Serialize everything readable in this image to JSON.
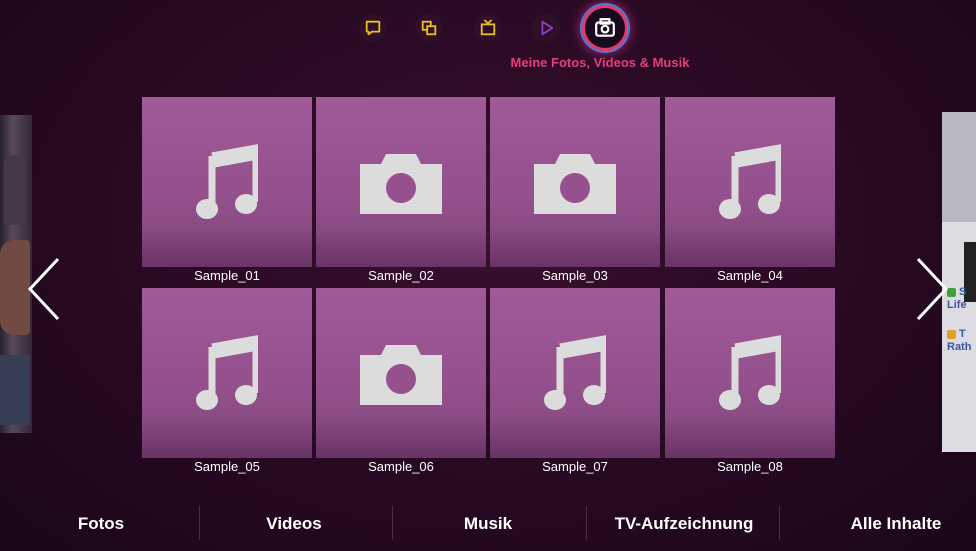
{
  "top_nav": {
    "icons": [
      {
        "name": "chat-icon",
        "color": "#e8c020"
      },
      {
        "name": "devices-icon",
        "color": "#e8c020"
      },
      {
        "name": "tv-icon",
        "color": "#e8c020"
      },
      {
        "name": "play-icon",
        "color": "#9040c0"
      },
      {
        "name": "camera-icon",
        "color": "#ffffff",
        "active": true
      }
    ],
    "active_title": "Meine Fotos, Videos & Musik"
  },
  "side_preview_right": {
    "lines": [
      "S",
      "Life",
      "T",
      "Rath"
    ]
  },
  "grid": {
    "items": [
      {
        "label": "Sample_01",
        "icon": "music-note-icon"
      },
      {
        "label": "Sample_02",
        "icon": "camera-icon"
      },
      {
        "label": "Sample_03",
        "icon": "camera-icon"
      },
      {
        "label": "Sample_04",
        "icon": "music-note-icon"
      },
      {
        "label": "Sample_05",
        "icon": "music-note-icon"
      },
      {
        "label": "Sample_06",
        "icon": "camera-icon"
      },
      {
        "label": "Sample_07",
        "icon": "music-note-icon"
      },
      {
        "label": "Sample_08",
        "icon": "music-note-icon"
      }
    ]
  },
  "bottom_tabs": [
    "Fotos",
    "Videos",
    "Musik",
    "TV-Aufzeichnung",
    "Alle Inhalte"
  ],
  "colors": {
    "accent": "#e0407a",
    "tile": "#9a5492",
    "background": "#2a0a24"
  }
}
